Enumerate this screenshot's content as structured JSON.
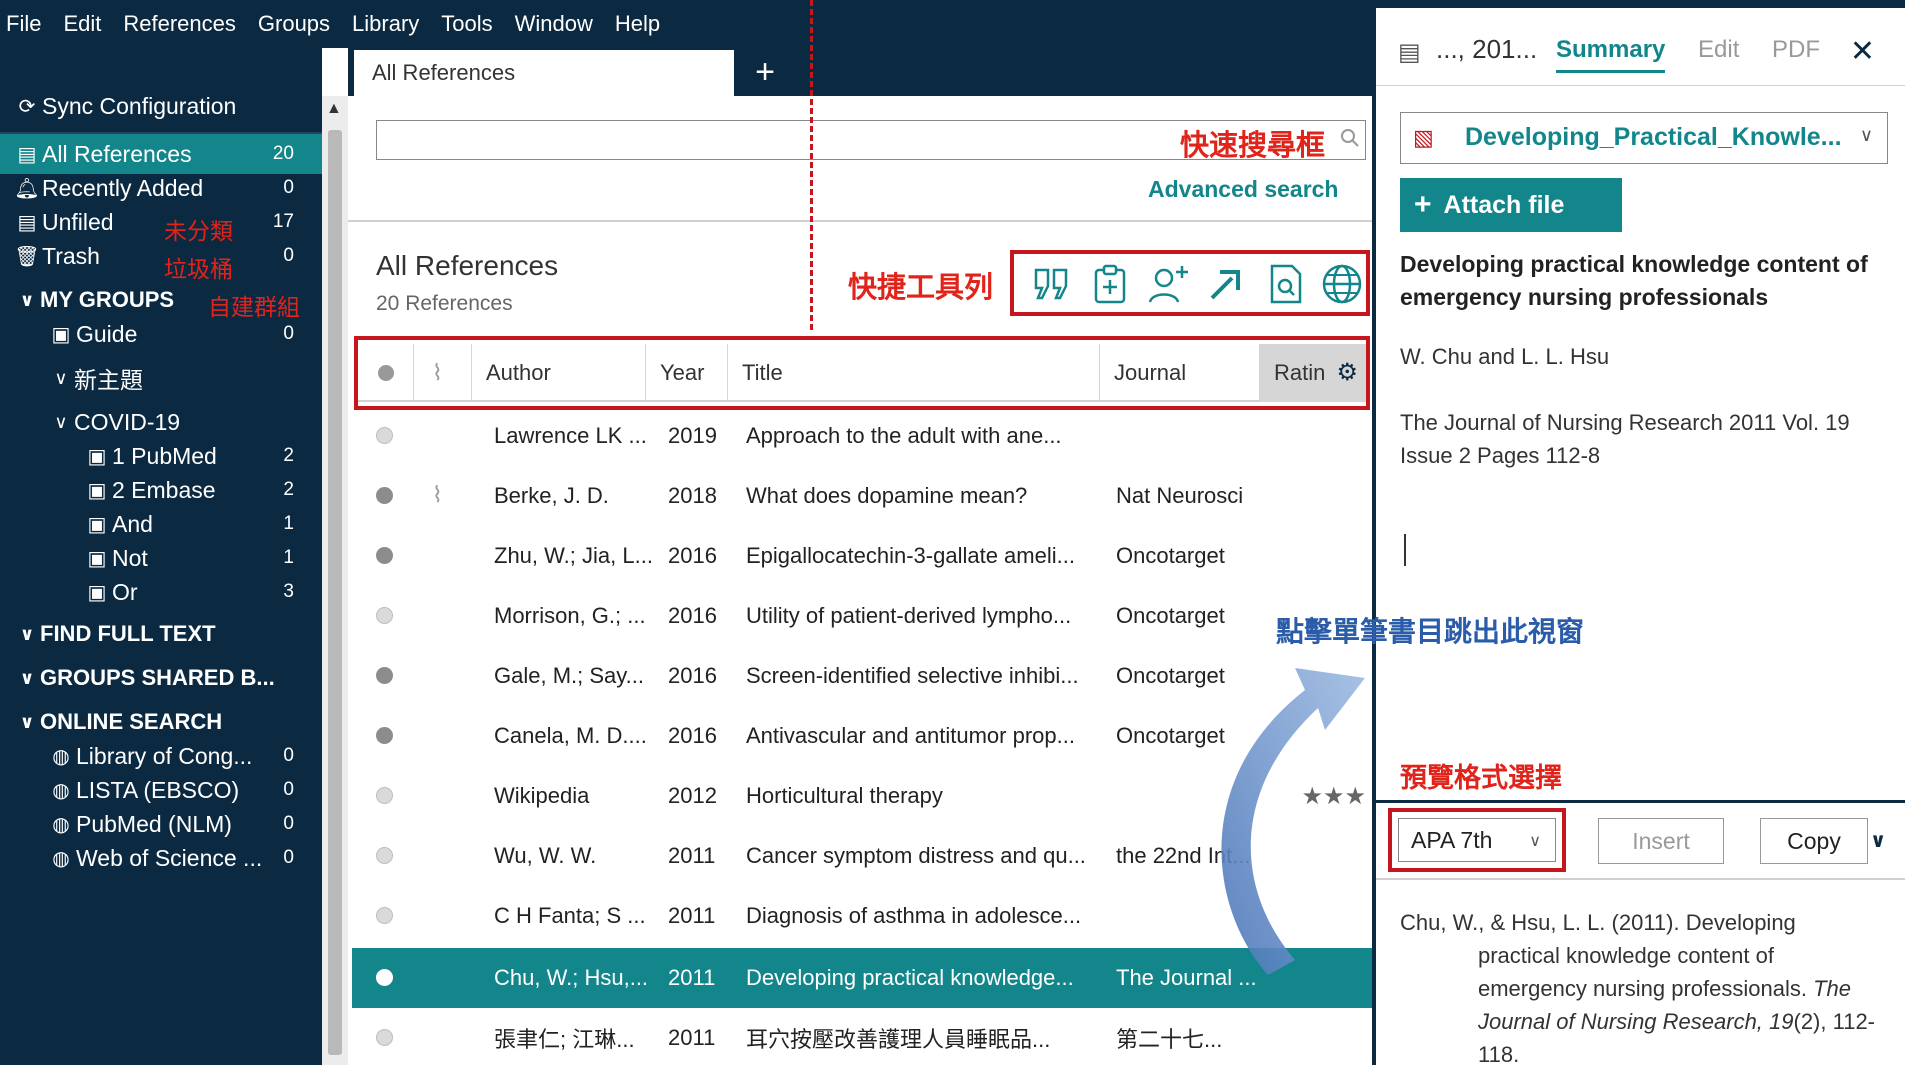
{
  "menu": [
    "File",
    "Edit",
    "References",
    "Groups",
    "Library",
    "Tools",
    "Window",
    "Help"
  ],
  "sidebar": {
    "sync": "Sync Configuration",
    "library": [
      {
        "label": "All References",
        "count": "20",
        "note": ""
      },
      {
        "label": "Recently Added",
        "count": "0",
        "note": ""
      },
      {
        "label": "Unfiled",
        "count": "17",
        "note": "未分類"
      },
      {
        "label": "Trash",
        "count": "0",
        "note": "垃圾桶"
      }
    ],
    "my_groups": {
      "label": "MY GROUPS",
      "note": "自建群組"
    },
    "groups": [
      {
        "label": "Guide",
        "count": "0"
      },
      {
        "label": "新主題",
        "count": ""
      },
      {
        "label": "COVID-19",
        "count": ""
      },
      {
        "label": "1 PubMed",
        "count": "2"
      },
      {
        "label": "2 Embase",
        "count": "2"
      },
      {
        "label": "And",
        "count": "1"
      },
      {
        "label": "Not",
        "count": "1"
      },
      {
        "label": "Or",
        "count": "3"
      }
    ],
    "find_full_text": "FIND FULL TEXT",
    "groups_shared": "GROUPS SHARED B...",
    "online_search": "ONLINE SEARCH",
    "online": [
      {
        "label": "Library of Cong...",
        "count": "0"
      },
      {
        "label": "LISTA (EBSCO)",
        "count": "0"
      },
      {
        "label": "PubMed (NLM)",
        "count": "0"
      },
      {
        "label": "Web of Science ...",
        "count": "0"
      }
    ]
  },
  "main": {
    "tab_label": "All References",
    "tab_plus": "+",
    "search_note": "快速搜尋框",
    "advanced_search": "Advanced search",
    "list_title": "All References",
    "list_count": "20 References",
    "toolbar_note": "快捷工具列",
    "columns": {
      "author": "Author",
      "year": "Year",
      "title": "Title",
      "journal": "Journal",
      "rating": "Ratin"
    },
    "rows": [
      {
        "status": "read",
        "clip": false,
        "author": "Lawrence LK ...",
        "year": "2019",
        "title": "Approach to the adult with ane...",
        "journal": "",
        "rating": "",
        "selected": false
      },
      {
        "status": "unread",
        "clip": true,
        "author": "Berke, J. D.",
        "year": "2018",
        "title": "What does dopamine mean?",
        "journal": "Nat Neurosci",
        "rating": "",
        "selected": false
      },
      {
        "status": "unread",
        "clip": false,
        "author": "Zhu, W.; Jia, L...",
        "year": "2016",
        "title": "Epigallocatechin-3-gallate ameli...",
        "journal": "Oncotarget",
        "rating": "",
        "selected": false
      },
      {
        "status": "read",
        "clip": false,
        "author": "Morrison, G.; ...",
        "year": "2016",
        "title": "Utility of patient-derived lympho...",
        "journal": "Oncotarget",
        "rating": "",
        "selected": false
      },
      {
        "status": "unread",
        "clip": false,
        "author": "Gale, M.; Say...",
        "year": "2016",
        "title": "Screen-identified selective inhibi...",
        "journal": "Oncotarget",
        "rating": "",
        "selected": false
      },
      {
        "status": "unread",
        "clip": false,
        "author": "Canela, M. D....",
        "year": "2016",
        "title": "Antivascular and antitumor prop...",
        "journal": "Oncotarget",
        "rating": "",
        "selected": false
      },
      {
        "status": "read",
        "clip": false,
        "author": "Wikipedia",
        "year": "2012",
        "title": "Horticultural therapy",
        "journal": "",
        "rating": "★★★",
        "selected": false
      },
      {
        "status": "read",
        "clip": false,
        "author": "Wu, W. W.",
        "year": "2011",
        "title": "Cancer symptom distress and qu...",
        "journal": "the 22nd Int...",
        "rating": "",
        "selected": false
      },
      {
        "status": "read",
        "clip": false,
        "author": "C H Fanta; S ...",
        "year": "2011",
        "title": "Diagnosis of asthma in adolesce...",
        "journal": "",
        "rating": "",
        "selected": false
      },
      {
        "status": "read",
        "clip": false,
        "author": "Chu, W.; Hsu,...",
        "year": "2011",
        "title": "Developing practical knowledge...",
        "journal": "The Journal ...",
        "rating": "",
        "selected": true
      },
      {
        "status": "read",
        "clip": false,
        "author": "張聿仁; 江琳...",
        "year": "2011",
        "title": "耳穴按壓改善護理人員睡眠品...",
        "journal": "第二十七...",
        "rating": "",
        "selected": false
      }
    ]
  },
  "right": {
    "short_ref": "..., 201...",
    "tabs": [
      "Summary",
      "Edit",
      "PDF"
    ],
    "close": "✕",
    "pdf_name": "Developing_Practical_Knowle...",
    "attach": "Attach file",
    "title": "Developing practical knowledge content of emergency nursing professionals",
    "authors": "W. Chu and L. L. Hsu",
    "source": "The Journal of Nursing Research 2011 Vol. 19 Issue 2 Pages 112-8",
    "popup_note": "點擊單筆書目跳出此視窗",
    "format_note": "預覽格式選擇",
    "format": "APA 7th",
    "insert": "Insert",
    "copy": "Copy",
    "citation_plain": "Chu, W., & Hsu, L. L. (2011). Developing practical knowledge content of emergency nursing professionals. ",
    "citation_journal": "The Journal of Nursing Research, 19",
    "citation_tail": "(2), 112-118."
  },
  "colors": {
    "navy": "#0b2a42",
    "teal": "#12868a",
    "red": "#c4161c",
    "blue": "#2a5caa"
  }
}
